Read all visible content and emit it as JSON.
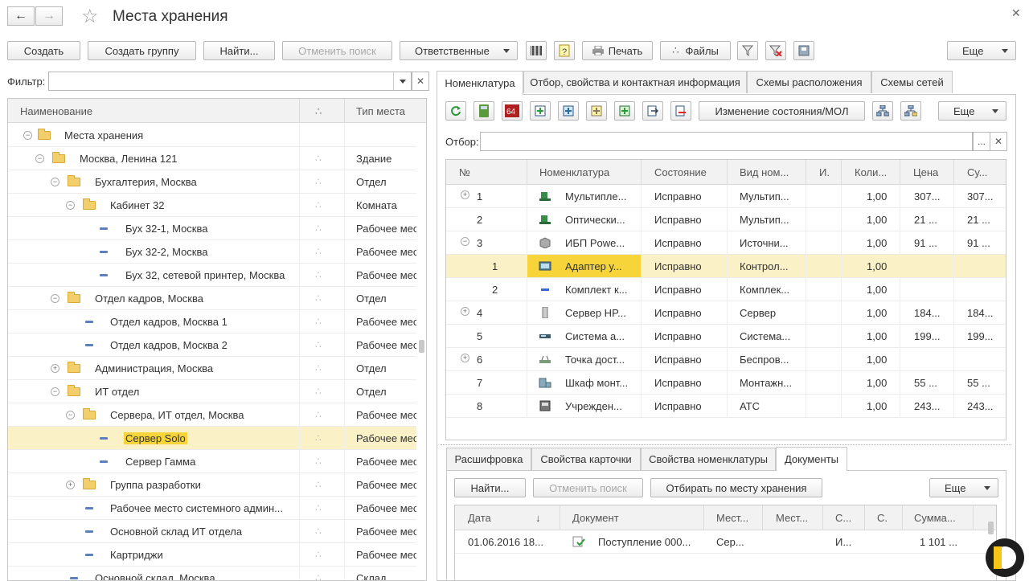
{
  "window": {
    "title": "Места хранения"
  },
  "toolbar": {
    "create": "Создать",
    "create_group": "Создать группу",
    "find": "Найти...",
    "cancel_search": "Отменить поиск",
    "responsible": "Ответственные",
    "print": "Печать",
    "files": "Файлы",
    "more": "Еще"
  },
  "filter": {
    "label": "Фильтр:",
    "value": ""
  },
  "tree": {
    "columns": [
      "Наименование",
      "Тип места"
    ],
    "rows": [
      {
        "name": "Места хранения",
        "type": ""
      },
      {
        "name": "Москва, Ленина 121",
        "type": "Здание"
      },
      {
        "name": "Бухгалтерия, Москва",
        "type": "Отдел"
      },
      {
        "name": "Кабинет 32",
        "type": "Комната"
      },
      {
        "name": "Бух 32-1, Москва",
        "type": "Рабочее место"
      },
      {
        "name": "Бух 32-2, Москва",
        "type": "Рабочее место"
      },
      {
        "name": "Бух 32, сетевой принтер, Москва",
        "type": "Рабочее место"
      },
      {
        "name": "Отдел кадров, Москва",
        "type": "Отдел"
      },
      {
        "name": "Отдел кадров, Москва 1",
        "type": "Рабочее место"
      },
      {
        "name": "Отдел кадров, Москва 2",
        "type": "Рабочее место"
      },
      {
        "name": "Администрация, Москва",
        "type": "Отдел"
      },
      {
        "name": "ИТ отдел",
        "type": "Отдел"
      },
      {
        "name": "Сервера, ИТ отдел, Москва",
        "type": "Рабочее место"
      },
      {
        "name": "Сервер Solo",
        "type": "Рабочее место"
      },
      {
        "name": "Сервер Гамма",
        "type": "Рабочее место"
      },
      {
        "name": "Группа разработки",
        "type": "Рабочее место"
      },
      {
        "name": "Рабочее место системного админ...",
        "type": "Рабочее место"
      },
      {
        "name": "Основной склад ИТ отдела",
        "type": "Рабочее место"
      },
      {
        "name": "Картриджи",
        "type": "Рабочее место"
      },
      {
        "name": "Основной склад, Москва",
        "type": "Склад"
      }
    ]
  },
  "right_tabs": [
    "Номенклатура",
    "Отбор, свойства и контактная информация",
    "Схемы расположения",
    "Схемы сетей"
  ],
  "nom_toolbar": {
    "change_state": "Изменение состояния/МОЛ",
    "more": "Еще",
    "selection_label": "Отбор:"
  },
  "grid": {
    "columns": [
      "№",
      "Номенклатура",
      "Состояние",
      "Вид ном...",
      "И.",
      "Коли...",
      "Цена",
      "Су..."
    ],
    "rows": [
      {
        "n": "1",
        "name": "Мультипле...",
        "state": "Исправно",
        "kind": "Мультип...",
        "qty": "1,00",
        "price": "307...",
        "sum": "307..."
      },
      {
        "n": "2",
        "name": "Оптически...",
        "state": "Исправно",
        "kind": "Мультип...",
        "qty": "1,00",
        "price": "21 ...",
        "sum": "21 ..."
      },
      {
        "n": "3",
        "name": "ИБП Powe...",
        "state": "Исправно",
        "kind": "Источни...",
        "qty": "1,00",
        "price": "91 ...",
        "sum": "91 ..."
      },
      {
        "n": "1",
        "name": "Адаптер у...",
        "state": "Исправно",
        "kind": "Контрол...",
        "qty": "1,00",
        "price": "",
        "sum": ""
      },
      {
        "n": "2",
        "name": "Комплект к...",
        "state": "Исправно",
        "kind": "Комплек...",
        "qty": "1,00",
        "price": "",
        "sum": ""
      },
      {
        "n": "4",
        "name": "Сервер HP...",
        "state": "Исправно",
        "kind": "Сервер",
        "qty": "1,00",
        "price": "184...",
        "sum": "184..."
      },
      {
        "n": "5",
        "name": "Система а...",
        "state": "Исправно",
        "kind": "Система...",
        "qty": "1,00",
        "price": "199...",
        "sum": "199..."
      },
      {
        "n": "6",
        "name": "Точка дост...",
        "state": "Исправно",
        "kind": "Беспров...",
        "qty": "1,00",
        "price": "",
        "sum": ""
      },
      {
        "n": "7",
        "name": "Шкаф монт...",
        "state": "Исправно",
        "kind": "Монтажн...",
        "qty": "1,00",
        "price": "55 ...",
        "sum": "55 ..."
      },
      {
        "n": "8",
        "name": "Учрежден...",
        "state": "Исправно",
        "kind": "АТС",
        "qty": "1,00",
        "price": "243...",
        "sum": "243..."
      }
    ]
  },
  "bottom_tabs": [
    "Расшифровка",
    "Свойства карточки",
    "Свойства номенклатуры",
    "Документы"
  ],
  "docs_toolbar": {
    "find": "Найти...",
    "cancel_search": "Отменить поиск",
    "filter_by_place": "Отбирать по месту хранения",
    "more": "Еще"
  },
  "docs_grid": {
    "columns": [
      "Дата",
      "Документ",
      "Мест...",
      "Мест...",
      "С...",
      "С.",
      "Сумма..."
    ],
    "rows": [
      {
        "date": "01.06.2016 18...",
        "doc": "Поступление 000...",
        "place1": "Сер...",
        "place2": "",
        "s1": "И...",
        "s2": "",
        "sum": "1 101 ..."
      }
    ]
  },
  "colors": {
    "selection": "#fbf1c7",
    "active_cell": "#f7d53a",
    "folder": "#f2cf6b",
    "logo": "#f5c518"
  }
}
